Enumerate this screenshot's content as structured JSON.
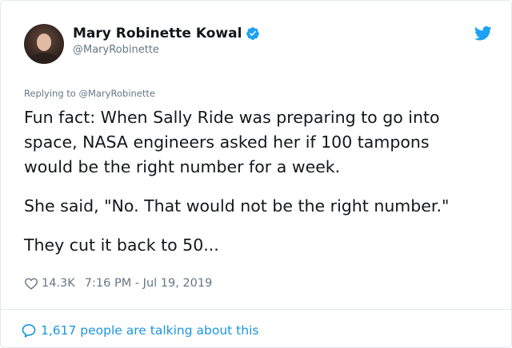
{
  "author": {
    "name": "Mary Robinette Kowal",
    "handle": "@MaryRobinette",
    "verified_icon": "verified-badge-icon",
    "avatar": "author-avatar"
  },
  "brand": {
    "icon": "twitter-bird-icon",
    "color": "#1da1f2"
  },
  "reply": {
    "prefix": "Replying to",
    "handle": "@MaryRobinette"
  },
  "tweet": {
    "paragraphs": [
      "Fun fact: When Sally Ride was preparing to go into\nspace, NASA engineers asked her if 100 tampons\nwould be the right number for a week.",
      "She said, \"No. That would not be the right number.\"",
      "They cut it back to 50..."
    ]
  },
  "meta": {
    "like_icon": "heart-outline-icon",
    "likes": "14.3K",
    "timestamp": "7:16 PM - Jul 19, 2019"
  },
  "footer": {
    "icon": "speech-bubble-icon",
    "talking_text": "1,617 people are talking about this",
    "link_color": "#1b95e0"
  }
}
